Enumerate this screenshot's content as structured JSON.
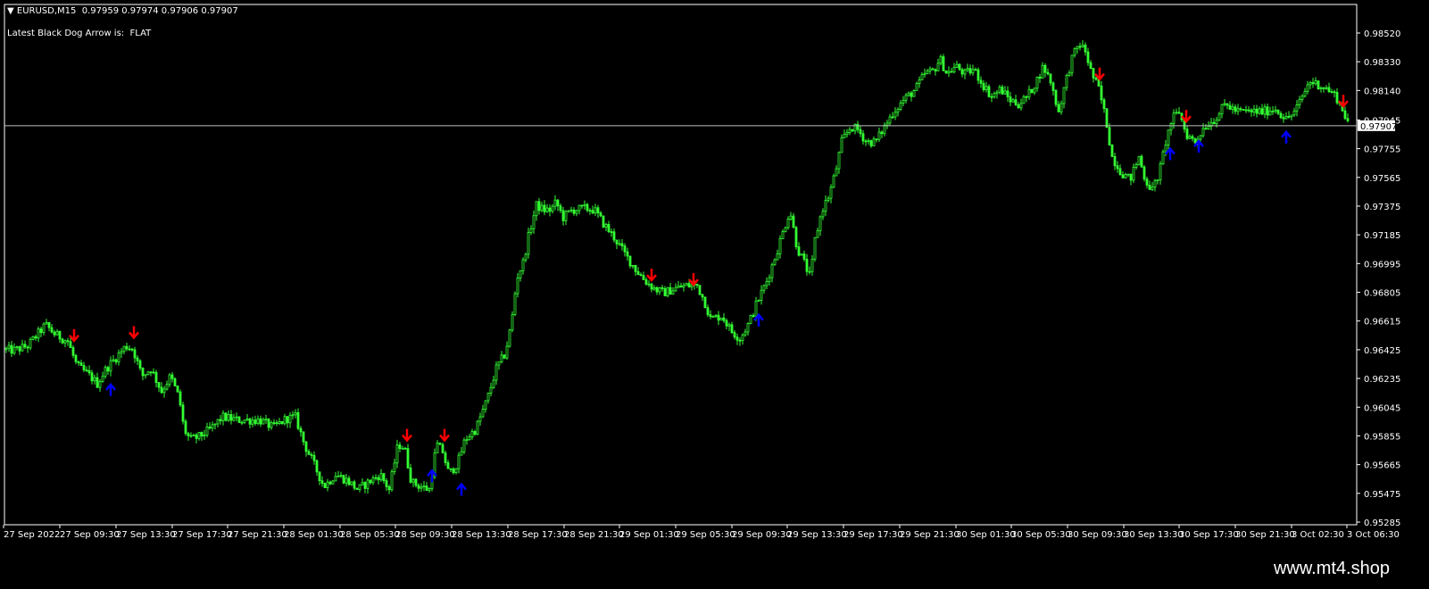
{
  "header": {
    "symbol": "EURUSD,M15",
    "ohlc": "0.97959 0.97974 0.97906 0.97907",
    "arrow_label": "Latest Black Dog Arrow is:",
    "arrow_value": "FLAT"
  },
  "watermark": "www.mt4.shop",
  "colors": {
    "background": "#000000",
    "candle": "#33ff33",
    "arrow_down": "#ff0000",
    "arrow_up": "#0000ff",
    "bid_line": "#c0c0c0",
    "axis": "#ffffff"
  },
  "chart_data": {
    "type": "candlestick",
    "symbol": "EURUSD",
    "timeframe": "M15",
    "current_price": 0.97907,
    "current_price_label": "0.97907",
    "ylim": [
      0.9519,
      0.9861
    ],
    "y_ticks": [
      "0.98520",
      "0.98330",
      "0.98140",
      "0.97945",
      "0.97755",
      "0.97565",
      "0.97375",
      "0.97185",
      "0.96995",
      "0.96805",
      "0.96615",
      "0.96425",
      "0.96235",
      "0.96045",
      "0.95855",
      "0.95665",
      "0.95475",
      "0.95285"
    ],
    "x_ticks": [
      "27 Sep 2022",
      "27 Sep 09:30",
      "27 Sep 13:30",
      "27 Sep 17:30",
      "27 Sep 21:30",
      "28 Sep 01:30",
      "28 Sep 05:30",
      "28 Sep 09:30",
      "28 Sep 13:30",
      "28 Sep 17:30",
      "28 Sep 21:30",
      "29 Sep 01:30",
      "29 Sep 05:30",
      "29 Sep 09:30",
      "29 Sep 13:30",
      "29 Sep 17:30",
      "29 Sep 21:30",
      "30 Sep 01:30",
      "30 Sep 05:30",
      "30 Sep 09:30",
      "30 Sep 13:30",
      "30 Sep 17:30",
      "30 Sep 21:30",
      "3 Oct 02:30",
      "3 Oct 06:30"
    ],
    "price_path": [
      [
        0,
        0.9643
      ],
      [
        14,
        0.9642
      ],
      [
        30,
        0.9645
      ],
      [
        40,
        0.9652
      ],
      [
        50,
        0.9659
      ],
      [
        60,
        0.9653
      ],
      [
        75,
        0.9648
      ],
      [
        85,
        0.9632
      ],
      [
        100,
        0.9625
      ],
      [
        108,
        0.962
      ],
      [
        118,
        0.963
      ],
      [
        130,
        0.9638
      ],
      [
        140,
        0.9645
      ],
      [
        148,
        0.9643
      ],
      [
        158,
        0.9625
      ],
      [
        168,
        0.963
      ],
      [
        180,
        0.9615
      ],
      [
        190,
        0.9625
      ],
      [
        200,
        0.961
      ],
      [
        205,
        0.959
      ],
      [
        212,
        0.9583
      ],
      [
        222,
        0.9585
      ],
      [
        235,
        0.959
      ],
      [
        248,
        0.9598
      ],
      [
        265,
        0.9596
      ],
      [
        290,
        0.9596
      ],
      [
        305,
        0.9591
      ],
      [
        320,
        0.9597
      ],
      [
        330,
        0.9598
      ],
      [
        340,
        0.958
      ],
      [
        352,
        0.9565
      ],
      [
        362,
        0.9552
      ],
      [
        375,
        0.956
      ],
      [
        388,
        0.9556
      ],
      [
        400,
        0.955
      ],
      [
        412,
        0.9555
      ],
      [
        425,
        0.956
      ],
      [
        435,
        0.955
      ],
      [
        445,
        0.958
      ],
      [
        452,
        0.9578
      ],
      [
        460,
        0.9555
      ],
      [
        470,
        0.9552
      ],
      [
        480,
        0.955
      ],
      [
        488,
        0.958
      ],
      [
        495,
        0.9575
      ],
      [
        502,
        0.956
      ],
      [
        512,
        0.9568
      ],
      [
        520,
        0.9583
      ],
      [
        532,
        0.959
      ],
      [
        545,
        0.961
      ],
      [
        555,
        0.963
      ],
      [
        565,
        0.964
      ],
      [
        572,
        0.966
      ],
      [
        578,
        0.969
      ],
      [
        585,
        0.97
      ],
      [
        592,
        0.972
      ],
      [
        600,
        0.9738
      ],
      [
        608,
        0.9735
      ],
      [
        616,
        0.9735
      ],
      [
        622,
        0.974
      ],
      [
        630,
        0.973
      ],
      [
        640,
        0.9735
      ],
      [
        655,
        0.9736
      ],
      [
        665,
        0.9735
      ],
      [
        675,
        0.9726
      ],
      [
        688,
        0.9716
      ],
      [
        700,
        0.9705
      ],
      [
        712,
        0.9695
      ],
      [
        722,
        0.9688
      ],
      [
        732,
        0.9683
      ],
      [
        742,
        0.968
      ],
      [
        755,
        0.9683
      ],
      [
        768,
        0.9685
      ],
      [
        780,
        0.9685
      ],
      [
        788,
        0.9675
      ],
      [
        795,
        0.9663
      ],
      [
        808,
        0.9665
      ],
      [
        818,
        0.9655
      ],
      [
        828,
        0.965
      ],
      [
        838,
        0.966
      ],
      [
        848,
        0.9675
      ],
      [
        858,
        0.9688
      ],
      [
        868,
        0.9705
      ],
      [
        876,
        0.972
      ],
      [
        884,
        0.9735
      ],
      [
        892,
        0.971
      ],
      [
        900,
        0.97
      ],
      [
        907,
        0.969
      ],
      [
        912,
        0.9715
      ],
      [
        920,
        0.9735
      ],
      [
        928,
        0.9745
      ],
      [
        935,
        0.976
      ],
      [
        942,
        0.978
      ],
      [
        952,
        0.979
      ],
      [
        960,
        0.9788
      ],
      [
        970,
        0.978
      ],
      [
        980,
        0.978
      ],
      [
        990,
        0.979
      ],
      [
        1000,
        0.98
      ],
      [
        1012,
        0.9808
      ],
      [
        1025,
        0.9815
      ],
      [
        1035,
        0.9825
      ],
      [
        1045,
        0.9827
      ],
      [
        1052,
        0.9835
      ],
      [
        1060,
        0.9825
      ],
      [
        1070,
        0.983
      ],
      [
        1080,
        0.9825
      ],
      [
        1090,
        0.9828
      ],
      [
        1100,
        0.9818
      ],
      [
        1110,
        0.981
      ],
      [
        1120,
        0.9815
      ],
      [
        1130,
        0.9808
      ],
      [
        1140,
        0.9805
      ],
      [
        1150,
        0.981
      ],
      [
        1160,
        0.982
      ],
      [
        1168,
        0.983
      ],
      [
        1176,
        0.982
      ],
      [
        1185,
        0.98
      ],
      [
        1193,
        0.982
      ],
      [
        1200,
        0.9835
      ],
      [
        1208,
        0.9845
      ],
      [
        1215,
        0.984
      ],
      [
        1222,
        0.9825
      ],
      [
        1230,
        0.9815
      ],
      [
        1238,
        0.9795
      ],
      [
        1245,
        0.977
      ],
      [
        1255,
        0.976
      ],
      [
        1265,
        0.9755
      ],
      [
        1275,
        0.977
      ],
      [
        1282,
        0.9755
      ],
      [
        1290,
        0.9748
      ],
      [
        1298,
        0.976
      ],
      [
        1305,
        0.978
      ],
      [
        1312,
        0.9795
      ],
      [
        1320,
        0.98
      ],
      [
        1328,
        0.9785
      ],
      [
        1338,
        0.978
      ],
      [
        1348,
        0.979
      ],
      [
        1360,
        0.9795
      ],
      [
        1372,
        0.9805
      ],
      [
        1385,
        0.98
      ],
      [
        1400,
        0.98
      ],
      [
        1415,
        0.98
      ],
      [
        1428,
        0.9802
      ],
      [
        1440,
        0.9795
      ],
      [
        1450,
        0.98
      ],
      [
        1458,
        0.981
      ],
      [
        1466,
        0.982
      ],
      [
        1476,
        0.9818
      ],
      [
        1486,
        0.9815
      ],
      [
        1496,
        0.981
      ],
      [
        1504,
        0.98
      ],
      [
        1511,
        0.9791
      ]
    ],
    "arrows_down": [
      [
        83,
        0.9652
      ],
      [
        150,
        0.9654
      ],
      [
        456,
        0.9586
      ],
      [
        498,
        0.9586
      ],
      [
        730,
        0.9692
      ],
      [
        777,
        0.9689
      ],
      [
        1232,
        0.9825
      ],
      [
        1329,
        0.9797
      ],
      [
        1505,
        0.9807
      ]
    ],
    "arrows_up": [
      [
        124,
        0.9616
      ],
      [
        484,
        0.9559
      ],
      [
        517,
        0.955
      ],
      [
        850,
        0.9662
      ],
      [
        1311,
        0.9772
      ],
      [
        1343,
        0.9777
      ],
      [
        1441,
        0.9783
      ]
    ]
  }
}
